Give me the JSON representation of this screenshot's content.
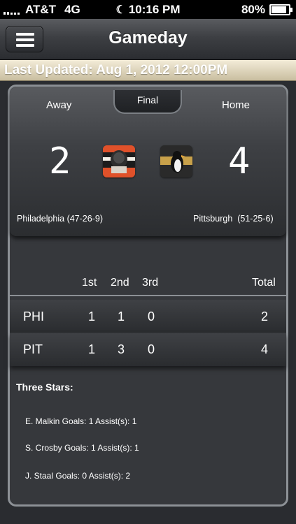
{
  "status_bar": {
    "carrier": "AT&T",
    "network": "4G",
    "time": "10:16 PM",
    "battery": "80%",
    "battery_level": 0.8
  },
  "nav": {
    "title": "Gameday",
    "menu_icon": "hamburger-menu-icon"
  },
  "last_updated": "Last Updated: Aug 1, 2012 12:00PM",
  "game": {
    "status": "Final",
    "away": {
      "label": "Away",
      "score": "2",
      "team": "Philadelphia (47-26-9)",
      "logo_icon": "flyers-logo-icon"
    },
    "home": {
      "label": "Home",
      "score": "4",
      "team": "Pittsburgh  (51-25-6)",
      "logo_icon": "penguins-logo-icon"
    }
  },
  "box_score": {
    "headers": [
      "1st",
      "2nd",
      "3rd",
      "Total"
    ],
    "rows": [
      {
        "team": "PHI",
        "p1": "1",
        "p2": "1",
        "p3": "0",
        "total": "2"
      },
      {
        "team": "PIT",
        "p1": "1",
        "p2": "3",
        "p3": "0",
        "total": "4"
      }
    ]
  },
  "three_stars": {
    "title": "Three Stars:",
    "items": [
      "E. Malkin Goals: 1 Assist(s): 1",
      "S. Crosby Goals: 1 Assist(s): 1",
      "J. Staal Goals: 0 Assist(s): 2"
    ]
  }
}
